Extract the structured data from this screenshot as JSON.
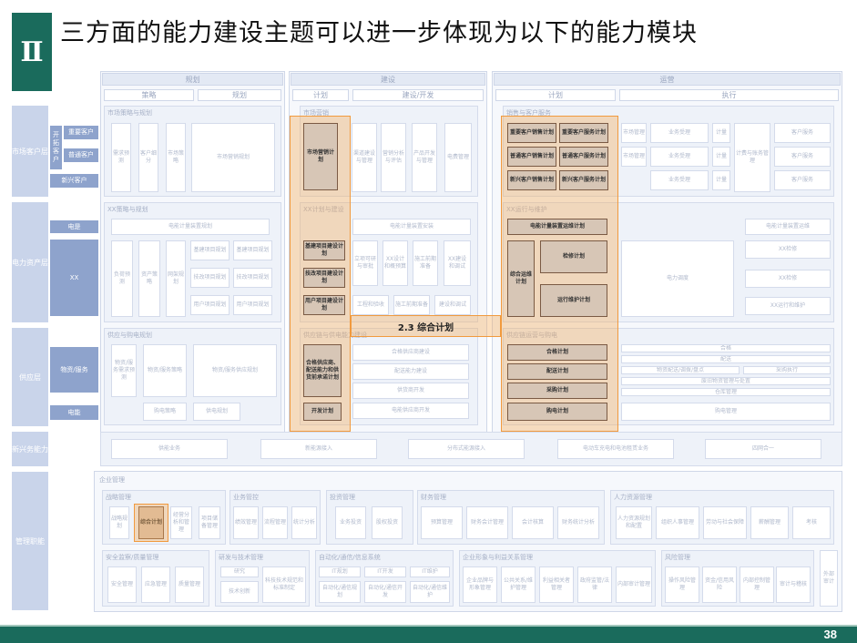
{
  "header": {
    "mark": "Ⅱ",
    "title": "三方面的能力建设主题可以进一步体现为以下的能力模块"
  },
  "page_number": "38",
  "columns": {
    "planning": {
      "label": "规划",
      "sub1": "策略",
      "sub2": "规划"
    },
    "construction": {
      "label": "建设",
      "sub1": "计划",
      "sub2": "建设/开发"
    },
    "operation": {
      "label": "运营",
      "sub1": "计划",
      "sub2": "执行"
    }
  },
  "rows": {
    "market": "市场客户层",
    "market_sub": "开拓客户",
    "market_sub1": "重要客户",
    "market_sub2": "普通客户",
    "market_sub3": "新兴客户",
    "power": "电力资产层",
    "power_sub1": "电是",
    "power_sub2": "XX",
    "supply": "供应层",
    "supply_sub1": "物资/服务",
    "supply_sub2": "电能",
    "support": "新兴务能力",
    "mgmt": "管理职能"
  },
  "market_row": {
    "planning_title": "市场策略与规划",
    "planning_boxes": [
      "需求预测",
      "客户细分",
      "市场策略",
      "市场营销规划"
    ],
    "construction_title": "市场营销",
    "construction_hl": "市场营销计划",
    "construction_boxes": [
      "渠道建设与管理",
      "营销分析与评估",
      "产品开发与管理",
      "电费管理"
    ],
    "op_title": "销售与客户服务",
    "op_hl": [
      "重要客户销售计划",
      "重要客户服务计划",
      "普通客户销售计划",
      "普通客户服务计划",
      "新兴客户销售计划",
      "新兴客户服务计划"
    ],
    "op_boxes": [
      "市场管理",
      "业务受理",
      "计量",
      "计费与账务管理",
      "客户服务",
      "市场管理",
      "业务受理",
      "计量",
      "客户服务",
      "业务受理",
      "计量",
      "客户服务"
    ]
  },
  "power_row": {
    "planning_title": "XX策略与规划",
    "planning_wide": "电能计量装置规划",
    "planning_boxes": [
      "负荷预测",
      "资产策略",
      "网架规划",
      "基建项目规划",
      "基建项目规划",
      "技改项目规划",
      "技改项目规划",
      "用户项目规划",
      "用户项目规划"
    ],
    "construction_title": "XX计划与建设",
    "construction_wide": "电能计量装置安装",
    "construction_hl": [
      "基建项目建设计划",
      "技改项目建设计划",
      "用户项目建设计划"
    ],
    "construction_boxes": [
      "立项可研与审批",
      "XX设计和概预算",
      "施工前期准备",
      "XX建设和调试",
      "工程和验收",
      "施工前期准备",
      "建设和调试"
    ],
    "op_title": "XX运行与维护",
    "op_hl_wide": "电能计量装置运维计划",
    "op_hl": [
      "综合运维计划",
      "检修计划",
      "运行维护计划"
    ],
    "op_boxes": [
      "电能计量装置运维",
      "XX检修",
      "电力调度",
      "XX检修",
      "XX运行和维护"
    ]
  },
  "link_label": "2.3 综合计划",
  "supply_row": {
    "planning_title": "供应与购电规划",
    "planning_boxes": [
      "物资/服务需求预测",
      "物资/服务策略",
      "物资/服务供应规划",
      "购电策略",
      "供电规划"
    ],
    "construction_title": "供应链与供电能力建设",
    "construction_hl": [
      "合格供应商、配送能力和供货前承诺计划",
      "开发计划"
    ],
    "construction_boxes": [
      "合格供应商建设",
      "配送能力建设",
      "供货商开发",
      "电能供应商开发"
    ],
    "op_title": "供应链运营与购电",
    "op_hl": [
      "合格计划",
      "配送计划",
      "采购计划",
      "购电计划"
    ],
    "op_boxes": [
      "合格",
      "配送",
      "物资配送/调拨/盘点",
      "采购执行",
      "废旧物资管理与处置",
      "仓库管理",
      "购电管理"
    ]
  },
  "support_row": {
    "boxes": [
      "供能业务",
      "新能源接入",
      "分布式能源接入",
      "电动车充电和电池租赁业务",
      "四网合一"
    ]
  },
  "mgmt_row": {
    "outer_title": "企业管理",
    "strategy_title": "战略管理",
    "strategy_boxes": [
      "战略规划",
      "综合计划",
      "经营分析和管理",
      "项目储备管理"
    ],
    "biz_title": "业务管控",
    "biz_boxes": [
      "绩效管理",
      "流程管理",
      "统计分析"
    ],
    "invest_title": "投资管理",
    "invest_boxes": [
      "业务投资",
      "股权投资"
    ],
    "finance_title": "财务管理",
    "finance_boxes": [
      "预算管理",
      "财务会计管理",
      "会计核算",
      "财务统计分析"
    ],
    "hr_title": "人力资源管理",
    "hr_boxes": [
      "人力资源规划和配置",
      "组织人事管理",
      "劳动与社会保障",
      "薪酬管理",
      "考核",
      "培训与开发"
    ],
    "safety_title": "安全监察/质量管理",
    "safety_boxes": [
      "安全管理",
      "应急管理",
      "质量管理"
    ],
    "tech_title": "研发与技术管理",
    "tech_boxes": [
      "研究",
      "技术创新",
      "科技技术规范和标准制定"
    ],
    "it_title": "自动化/通信/信息系统",
    "it_boxes": [
      "IT规划",
      "IT开发",
      "IT维护",
      "自动化/通信规划",
      "自动化/通信开发",
      "自动化/通信维护"
    ],
    "brand_title": "企业形象与利益关系管理",
    "brand_boxes": [
      "企业品牌与形象管理",
      "公共关系/维护管理",
      "利益相关者管理",
      "政府监管/法律",
      "内部审计管理"
    ],
    "risk_title": "风险管理",
    "risk_boxes": [
      "操作风险管理",
      "资金/信用风险",
      "内部控制管理",
      "审计与稽核"
    ],
    "side_box": "外部审计"
  }
}
